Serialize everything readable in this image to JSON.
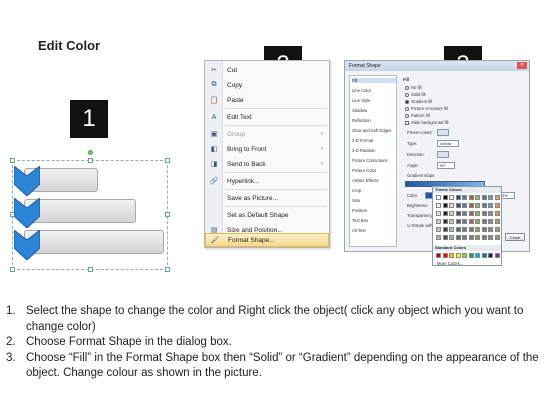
{
  "title": "Edit Color",
  "steps": [
    "1",
    "2",
    "3"
  ],
  "menu": {
    "items": [
      {
        "icon": "✂",
        "label": "Cut",
        "icon_name": "cut-icon"
      },
      {
        "icon": "⧉",
        "label": "Copy",
        "icon_name": "copy-icon"
      },
      {
        "icon": "📋",
        "label": "Paste",
        "icon_name": "paste-icon"
      },
      {
        "icon": "A",
        "label": "Edit Text",
        "icon_name": "edit-text-icon"
      },
      {
        "icon": "▣",
        "label": "Group",
        "icon_name": "group-icon",
        "submenu": true,
        "disabled": true
      },
      {
        "icon": "◧",
        "label": "Bring to Front",
        "icon_name": "bring-front-icon",
        "submenu": true
      },
      {
        "icon": "◨",
        "label": "Send to Back",
        "icon_name": "send-back-icon",
        "submenu": true
      },
      {
        "icon": "🔗",
        "label": "Hyperlink...",
        "icon_name": "hyperlink-icon"
      },
      {
        "icon": "",
        "label": "Save as Picture...",
        "icon_name": ""
      },
      {
        "icon": "",
        "label": "Set as Default Shape",
        "icon_name": ""
      },
      {
        "icon": "▤",
        "label": "Size and Position...",
        "icon_name": "size-position-icon"
      },
      {
        "icon": "🖌",
        "label": "Format Shape...",
        "icon_name": "format-shape-icon",
        "highlighted": true
      }
    ]
  },
  "dialog": {
    "title": "Format Shape",
    "nav": [
      "Fill",
      "Line Color",
      "Line Style",
      "Shadow",
      "Reflection",
      "Glow and Soft Edges",
      "3-D Format",
      "3-D Rotation",
      "Picture Corrections",
      "Picture Color",
      "Artistic Effects",
      "Crop",
      "Size",
      "Position",
      "Text Box",
      "Alt Text"
    ],
    "fill_heading": "Fill",
    "fill_options": [
      "No fill",
      "Solid fill",
      "Gradient fill",
      "Picture or texture fill",
      "Pattern fill",
      "Slide background fill"
    ],
    "selected_fill": "Gradient fill",
    "preset_label": "Preset colors:",
    "type_label": "Type:",
    "type_value": "Linear",
    "direction_label": "Direction:",
    "angle_label": "Angle:",
    "angle_value": "90°",
    "stops_label": "Gradient stops",
    "color_label": "Color",
    "position_label": "Position:",
    "position_value": "0%",
    "brightness_label": "Brightness:",
    "transparency_label": "Transparency:",
    "rotate_label": "Rotate with shape",
    "theme_colors_label": "Theme Colors",
    "standard_colors_label": "Standard Colors",
    "more_colors_label": "More Colors...",
    "close_label": "Close"
  },
  "instructions": [
    {
      "num": "1.",
      "text": "Select the shape to change the color and Right click the object( click any object which you want to change color)"
    },
    {
      "num": "2.",
      "text": "Choose Format Shape in the dialog box."
    },
    {
      "num": "3.",
      "text": "Choose “Fill” in the Format Shape box then “Solid” or “Gradient” depending on the appearance of the object. Change colour as shown in the picture."
    }
  ],
  "colors": {
    "chevron": "#2b86d8",
    "accent": "#1a5aa8",
    "menu_highlight": "#f7d98a"
  }
}
